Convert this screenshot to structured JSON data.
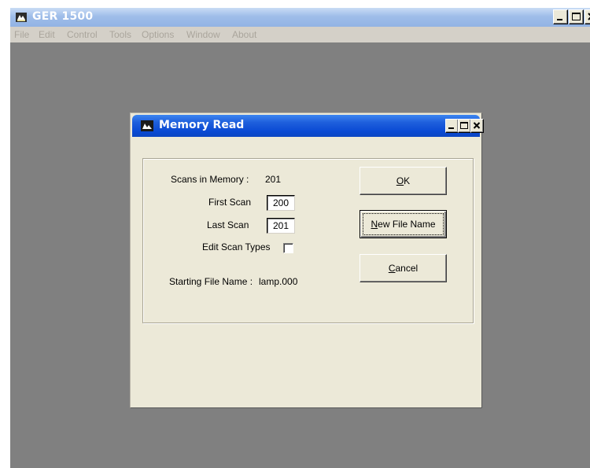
{
  "main_window": {
    "title": "GER 1500",
    "menu": [
      "File",
      "Edit",
      "Control",
      "Tools",
      "Options",
      "Window",
      "About"
    ]
  },
  "dialog": {
    "title": "Memory Read",
    "scans_in_memory_label": "Scans in Memory :",
    "scans_in_memory_value": "201",
    "first_scan_label": "First Scan",
    "first_scan_value": "200",
    "last_scan_label": "Last Scan",
    "last_scan_value": "201",
    "edit_scan_types_label": "Edit Scan Types",
    "edit_scan_types_checked": false,
    "starting_file_name_label": "Starting File Name :",
    "starting_file_name_value": "lamp.000",
    "buttons": {
      "ok": {
        "mnemonic": "O",
        "rest": "K"
      },
      "new_file_name": {
        "mnemonic": "N",
        "rest": "ew File Name"
      },
      "cancel": {
        "mnemonic": "C",
        "rest": "ancel"
      }
    }
  },
  "icons": {
    "main_app_icon": "app-icon",
    "dialog_icon": "app-icon",
    "minimize": "minimize-icon",
    "maximize": "maximize-icon",
    "close": "close-icon"
  },
  "colors": {
    "workspace": "#808080",
    "dialog_title_bar": "#0a4ad4",
    "main_title_bar": "#9fbde9",
    "dialog_face": "#ece9d8"
  }
}
